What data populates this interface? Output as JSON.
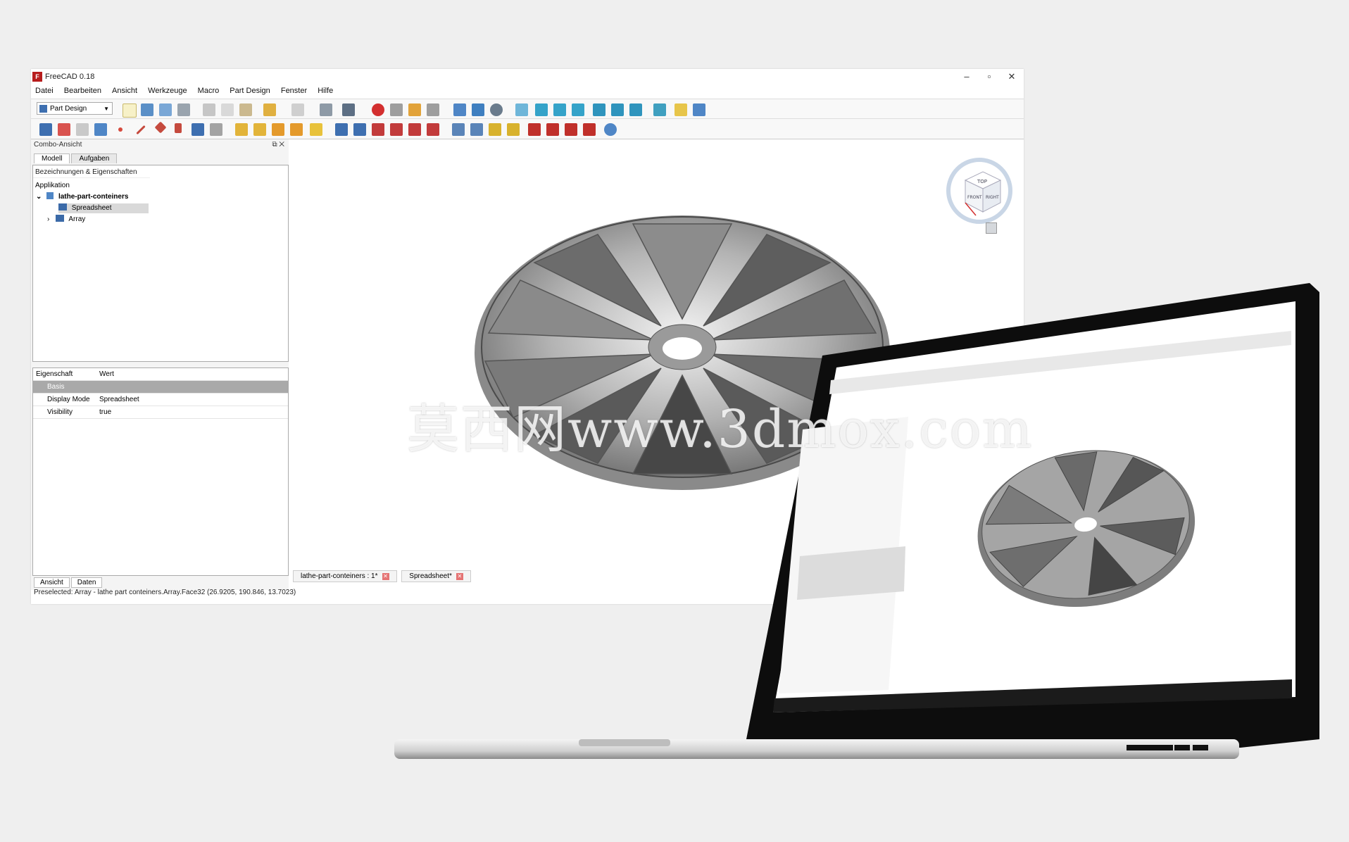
{
  "window": {
    "title": "FreeCAD 0.18",
    "app_icon": "freecad-logo-icon",
    "controls": {
      "minimize": "–",
      "maximize": "▫",
      "close": "✕"
    }
  },
  "menu": [
    "Datei",
    "Bearbeiten",
    "Ansicht",
    "Werkzeuge",
    "Macro",
    "Part Design",
    "Fenster",
    "Hilfe"
  ],
  "toolbar": {
    "workbench": "Part Design"
  },
  "combo": {
    "title": "Combo-Ansicht",
    "tabs": [
      "Modell",
      "Aufgaben"
    ],
    "tree_header": "Bezeichnungen & Eigenschaften",
    "tree": {
      "root": "Applikation",
      "document": "lathe-part-conteiners",
      "item1": "Spreadsheet",
      "item2": "Array"
    },
    "props": {
      "col1": "Eigenschaft",
      "col2": "Wert",
      "group": "Basis",
      "rows": [
        {
          "name": "Display Mode",
          "value": "Spreadsheet"
        },
        {
          "name": "Visibility",
          "value": "true"
        }
      ]
    },
    "bottom_tabs": [
      "Ansicht",
      "Daten"
    ]
  },
  "doc_tabs": [
    {
      "label": "lathe-part-conteiners : 1*"
    },
    {
      "label": "Spreadsheet*"
    }
  ],
  "status": "Preselected: Array - lathe part conteiners.Array.Face32 (26.9205, 190.846, 13.7023)",
  "navcube": {
    "top": "TOP",
    "front": "FRONT",
    "right": "RIGHT"
  },
  "watermark": "莫西网www.3dmox.com",
  "colors": {
    "accent": "#3e6fb0",
    "record": "#d32f2f",
    "laptop_bezel": "#0d0d0d"
  }
}
